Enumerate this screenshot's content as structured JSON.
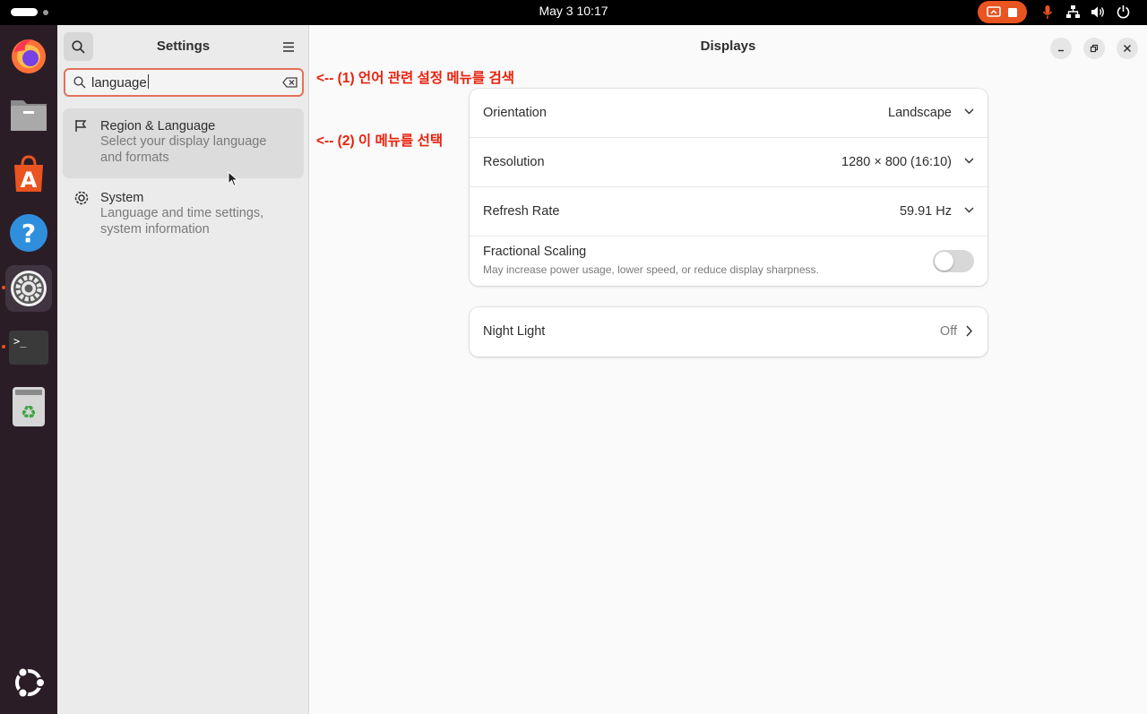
{
  "topbar": {
    "clock": "May 3  10:17"
  },
  "dock": {
    "items": [
      "firefox-icon",
      "files-icon",
      "app-center-icon",
      "help-icon",
      "settings-icon",
      "terminal-icon",
      "trash-icon",
      "ubuntu-apps-icon"
    ]
  },
  "sidebar": {
    "title": "Settings",
    "search": {
      "value": "language"
    },
    "results": [
      {
        "title": "Region & Language",
        "subtitle": "Select your display language\nand formats"
      },
      {
        "title": "System",
        "subtitle": "Language and time settings,\nsystem information"
      }
    ]
  },
  "annotations": [
    "<--  (1) 언어 관련 설정 메뉴를 검색",
    "<--  (2) 이 메뉴를 선택"
  ],
  "main": {
    "title": "Displays",
    "display_rows": [
      {
        "label": "Orientation",
        "value": "Landscape"
      },
      {
        "label": "Resolution",
        "value": "1280 × 800 (16:10)"
      },
      {
        "label": "Refresh Rate",
        "value": "59.91 Hz"
      }
    ],
    "fractional_scaling": {
      "label": "Fractional Scaling",
      "description": "May increase power usage, lower speed, or reduce display sharpness.",
      "enabled": false
    },
    "night_light": {
      "label": "Night Light",
      "value": "Off"
    }
  },
  "colors": {
    "accent": "#e95420",
    "annotation": "#e8220e",
    "search_border": "#e2725a"
  }
}
